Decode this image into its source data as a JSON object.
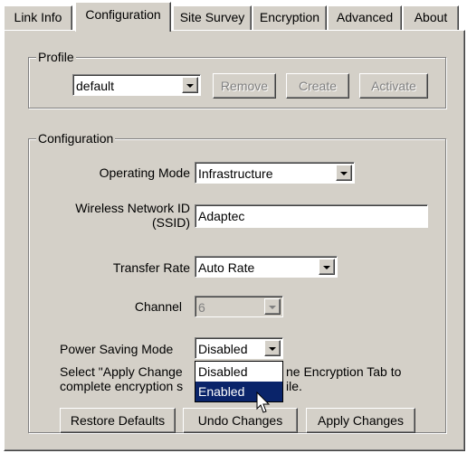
{
  "tabs": [
    {
      "label": "Link Info",
      "active": false
    },
    {
      "label": "Configuration",
      "active": true
    },
    {
      "label": "Site Survey",
      "active": false
    },
    {
      "label": "Encryption",
      "active": false
    },
    {
      "label": "Advanced",
      "active": false
    },
    {
      "label": "About",
      "active": false
    }
  ],
  "profile": {
    "group_title": "Profile",
    "selected": "default",
    "remove_label": "Remove",
    "create_label": "Create",
    "activate_label": "Activate"
  },
  "configuration": {
    "group_title": "Configuration",
    "operating_mode": {
      "label": "Operating Mode",
      "value": "Infrastructure"
    },
    "ssid": {
      "label_line1": "Wireless Network ID",
      "label_line2": "(SSID)",
      "value": "Adaptec"
    },
    "transfer_rate": {
      "label": "Transfer Rate",
      "value": "Auto Rate"
    },
    "channel": {
      "label": "Channel",
      "value": "6",
      "disabled": true
    },
    "power_saving": {
      "label": "Power Saving Mode",
      "value": "Disabled",
      "options": [
        "Disabled",
        "Enabled"
      ],
      "highlighted": "Enabled"
    },
    "note_line1_a": "Select \"Apply Change",
    "note_line1_b": "ne Encryption Tab to",
    "note_line2_a": "complete encryption s",
    "note_line2_b": "ile.",
    "restore_label": "Restore Defaults",
    "undo_label": "Undo Changes",
    "apply_label": "Apply Changes"
  },
  "colors": {
    "face": "#d4d0c8",
    "highlight": "#0a246a"
  }
}
